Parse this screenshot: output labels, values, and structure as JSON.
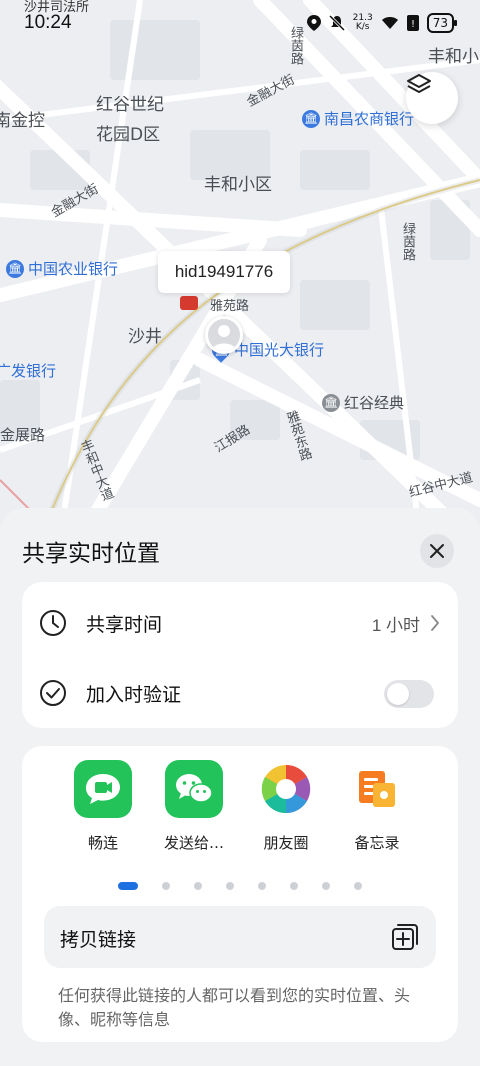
{
  "status_bar": {
    "top_label": "沙井司法所",
    "time": "10:24",
    "speed_value": "21.3",
    "speed_unit": "K/s",
    "battery": "73"
  },
  "map": {
    "areas": [
      "红谷世纪",
      "花园D区",
      "丰和小区",
      "南金控",
      "丰和小",
      "沙井"
    ],
    "roads": [
      "金融大街",
      "绿茵路",
      "金融大街",
      "绿茵路",
      "雅苑路",
      "江报路",
      "雅苑东路",
      "丰和中大道",
      "红谷中大道",
      "金展路"
    ],
    "pois": [
      {
        "name": "南昌农商银行",
        "icon": "bank-icon"
      },
      {
        "name": "中国农业银行",
        "icon": "bank-icon"
      },
      {
        "name": "中国光大银行",
        "icon": "bank-pin-icon"
      },
      {
        "name": "红谷经典",
        "icon": "building-icon"
      },
      {
        "name": "广发银行",
        "icon": "bank-icon"
      }
    ],
    "user_label": "hid19491776"
  },
  "sheet": {
    "title": "共享实时位置",
    "settings": {
      "share_time_label": "共享时间",
      "share_time_value": "1 小时",
      "verify_label": "加入时验证",
      "verify_enabled": false
    },
    "apps": [
      {
        "name": "畅连",
        "icon": "changlian-icon",
        "color": "#23c35a"
      },
      {
        "name": "发送给…",
        "icon": "wechat-icon",
        "color": "#22c35a"
      },
      {
        "name": "朋友圈",
        "icon": "moments-icon",
        "color": "#ffffff"
      },
      {
        "name": "备忘录",
        "icon": "notes-icon",
        "color": "#ffffff"
      }
    ],
    "page_dots": 8,
    "active_page": 1,
    "copy_link_label": "拷贝链接",
    "hint": "任何获得此链接的人都可以看到您的实时位置、头像、昵称等信息"
  },
  "colors": {
    "accent": "#1e6fe0",
    "map_bg": "#eceef1",
    "poi_blue": "#2f6fd6"
  }
}
